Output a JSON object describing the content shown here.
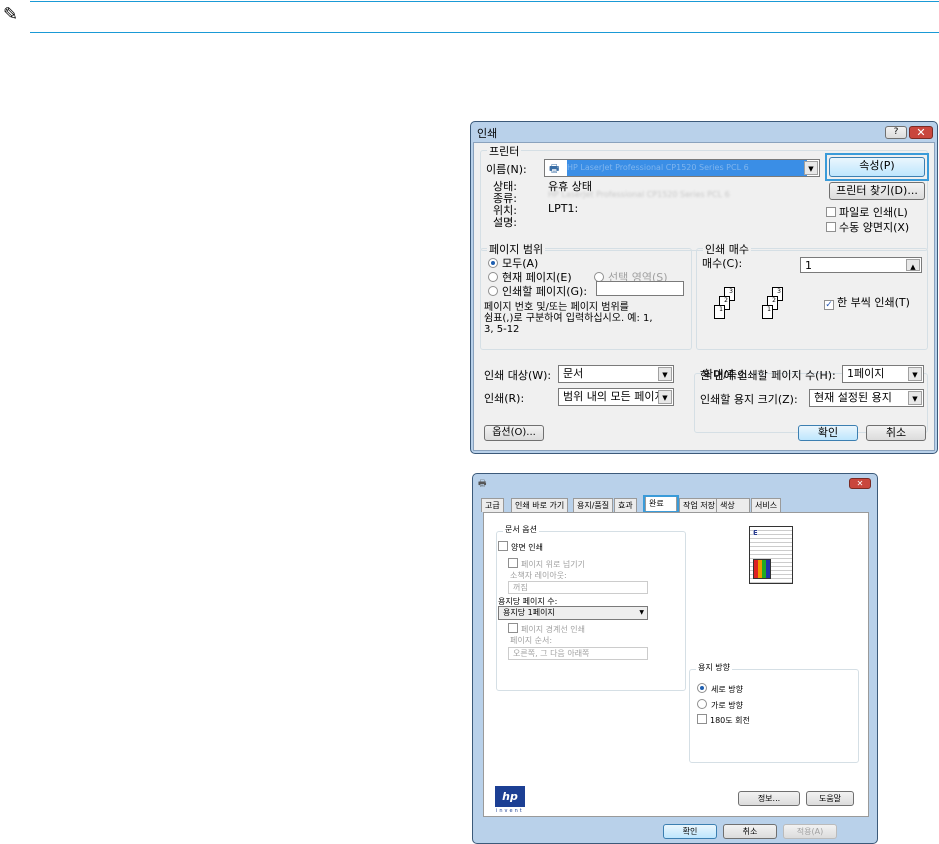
{
  "note": {
    "icon": "note-pencil-icon",
    "rule_color": "#1a9ad6"
  },
  "print_dialog": {
    "title": "인쇄",
    "printer_group": "프린터",
    "name_label": "이름(N):",
    "printer_name": "HP LaserJet Professional CP1520 Series PCL 6",
    "properties_button": "속성(P)",
    "find_printer_button": "프린터 찾기(D)...",
    "status_label": "상태:",
    "status_value": "유휴 상태",
    "type_label": "종류:",
    "type_value": "HP LaserJet Professional CP1520 Series PCL 6",
    "where_label": "위치:",
    "where_value": "LPT1:",
    "comment_label": "설명:",
    "print_to_file": "파일로 인쇄(L)",
    "manual_duplex": "수동 양면지(X)",
    "page_range_group": "페이지 범위",
    "all": "모두(A)",
    "current_page": "현재 페이지(E)",
    "selection": "선택 영역(S)",
    "pages": "인쇄할 페이지(G):",
    "pages_value": "",
    "range_hint": "페이지 번호 및/또는 페이지 범위를\n쉼표(,)로 구분하여 입력하십시오. 예: 1,\n3, 5-12",
    "copies_group": "인쇄 매수",
    "copies_label": "매수(C):",
    "copies_value": "1",
    "collate": "한 부씩 인쇄(T)",
    "page_numbers": [
      "1",
      "2",
      "3"
    ],
    "print_what_label": "인쇄 대상(W):",
    "print_what_value": "문서",
    "print_label": "인쇄(R):",
    "print_value": "범위 내의 모든 페이지",
    "zoom_group": "확대/축소",
    "pages_per_sheet_label": "한 면에 인쇄할 페이지 수(H):",
    "pages_per_sheet_value": "1페이지",
    "scale_label": "인쇄할 용지 크기(Z):",
    "scale_value": "현재 설정된 용지",
    "options_button": "옵션(O)...",
    "ok_button": "확인",
    "cancel_button": "취소"
  },
  "properties_dialog": {
    "tabs": [
      "고급",
      "인쇄 바로 가기",
      "용지/품질",
      "효과",
      "완료",
      "작업 저장",
      "색상",
      "서비스"
    ],
    "active_tab": 4,
    "doc_options_group": "문서 옵션",
    "duplex": "양면 인쇄",
    "flip_up": "페이지 위로 넘기기",
    "booklet_label": "소책자 레이아웃:",
    "booklet_value": "꺼짐",
    "pps_label": "용지당 페이지 수:",
    "pps_value": "용지당 1페이지",
    "borders": "페이지 경계선 인쇄",
    "order_label": "페이지 순서:",
    "order_value": "오른쪽, 그 다음 아래쪽",
    "orientation_group": "용지 방향",
    "portrait": "세로 방향",
    "landscape": "가로 방향",
    "rotate": "180도 회전",
    "logo_text": "invent",
    "about_button": "정보...",
    "help_button": "도움말",
    "ok_button": "확인",
    "cancel_button": "취소",
    "apply_button": "적용(A)"
  }
}
